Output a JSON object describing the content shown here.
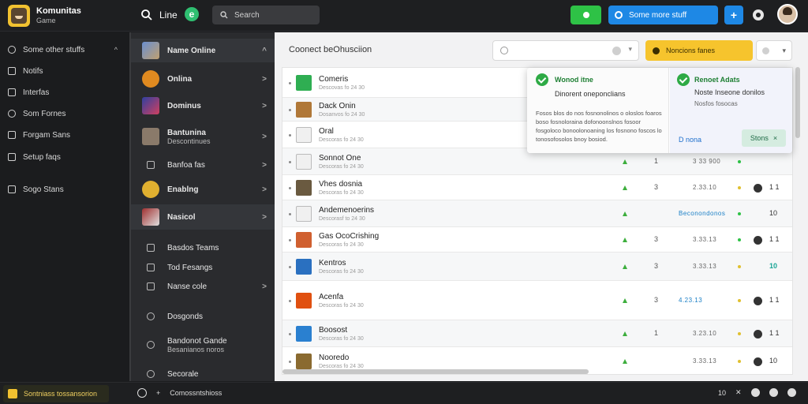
{
  "brand": {
    "title": "Komunitas",
    "subtitle": "Game"
  },
  "topbar": {
    "home_label": "Line",
    "e_badge": "e",
    "search_placeholder": "Search",
    "blue_button_label": "Some more stuff",
    "plus_label": "+"
  },
  "leftnav": {
    "items": [
      {
        "label": "Some other stuffs",
        "chev": "^"
      },
      {
        "label": "Notifs"
      },
      {
        "label": "Interfas"
      },
      {
        "label": "Som Fornes"
      },
      {
        "label": "Forgam Sans"
      },
      {
        "label": "Setup faqs"
      },
      {
        "label": "Sogo Stans"
      }
    ]
  },
  "categories": {
    "items": [
      {
        "label": "Name Online",
        "chev": "^"
      },
      {
        "label": "Onlina",
        "chev": ">"
      },
      {
        "label": "Dominus",
        "chev": ">"
      },
      {
        "label": "Bantunina",
        "sub": "Descontinues",
        "chev": ">"
      },
      {
        "label": "Banfoa fas",
        "chev": ">"
      },
      {
        "label": "Enablng",
        "chev": ">"
      },
      {
        "label": "Nasicol",
        "chev": ">"
      },
      {
        "label": "Basdos Teams"
      },
      {
        "label": "Tod Fesangs"
      },
      {
        "label": "Nanse cole",
        "chev": ">"
      },
      {
        "label": "Dosgonds"
      },
      {
        "label": "Bandonot Gande",
        "sub": "Besanianos noros"
      },
      {
        "label": "Secorale"
      }
    ]
  },
  "main": {
    "title": "Coonect beOhusciion",
    "yellow_button_label": "Noncions fanes",
    "table_rows": [
      {
        "name": "Comeris",
        "sub": "Descovas fo 24 30",
        "num": "",
        "val": "",
        "tail": ""
      },
      {
        "name": "Dack Onin",
        "sub": "Dosanvos fo 24 30",
        "num": "",
        "val": "",
        "tail": ""
      },
      {
        "name": "Oral",
        "sub": "Descoras fo 24 30",
        "num": "",
        "val": "",
        "tail": ""
      },
      {
        "name": "Sonnot One",
        "sub": "Descoras fo 24 30",
        "num": "1",
        "val": "3 33 900",
        "tail": ""
      },
      {
        "name": "Vhes dosnia",
        "sub": "Descoras fo 24 30",
        "num": "3",
        "val": "2.33.10",
        "tail": "1 1"
      },
      {
        "name": "Andemenoerins",
        "sub": "Descorasf to 24 30",
        "num": "",
        "val": "Beconondonos",
        "tail": "10"
      },
      {
        "name": "Gas OcoCrishing",
        "sub": "Descoras fo 24 30",
        "num": "3",
        "val": "3.33.13",
        "tail": "1 1"
      },
      {
        "name": "Kentros",
        "sub": "Descoras fo 24 30",
        "num": "3",
        "val": "3.33.13",
        "tail": "10"
      },
      {
        "name": "Acenfa",
        "sub": "Descoras fo 24 30",
        "num": "3",
        "val": "4.23.13",
        "tail": "1 1"
      },
      {
        "name": "Boosost",
        "sub": "Descoras fo 24 30",
        "num": "1",
        "val": "3.23.10",
        "tail": "1 1"
      },
      {
        "name": "Nooredo",
        "sub": "Descoras fo 24 30",
        "num": "",
        "val": "3.33.13",
        "tail": "10"
      }
    ]
  },
  "popup": {
    "left_title": "Wonod itne",
    "left_sub": "Dinorent oneponclians",
    "left_body": "Fosos blos do nos fosnonolinos o oloslos foaros boso fosnoloraina dofonoonslnos fosoor fosgoloco bonoolonoaning los fosnono foscos lo tonosofosolos bnoy bosiod.",
    "right_title": "Renoet Adats",
    "right_sub": "Noste Inseone donilos",
    "right_meta": "Nosfos fosocas",
    "link_label": "D nona",
    "green_button_label": "Stons"
  },
  "statusbar": {
    "left_label": "Sontniass tossansorion",
    "mid_label": "Comossntshioss",
    "right_num": "10"
  },
  "colors": {
    "accent_blue": "#1e88e5",
    "accent_green": "#2ec246",
    "accent_yellow": "#f6c42d",
    "status_teal": "#1aa596"
  }
}
